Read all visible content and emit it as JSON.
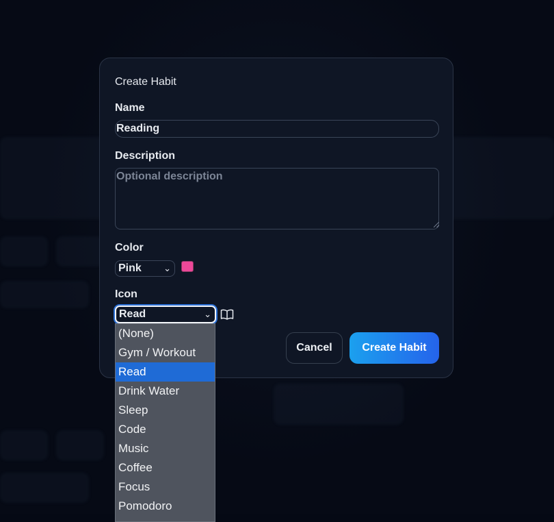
{
  "dialog": {
    "title": "Create Habit",
    "name": {
      "label": "Name",
      "value": "Reading"
    },
    "description": {
      "label": "Description",
      "value": "",
      "placeholder": "Optional description"
    },
    "color": {
      "label": "Color",
      "selected": "Pink",
      "swatch_color": "#ec4899"
    },
    "icon": {
      "label": "Icon",
      "selected": "Read",
      "preview_icon": "book-open-icon"
    },
    "buttons": {
      "cancel": "Cancel",
      "create": "Create Habit"
    }
  },
  "icon_dropdown": {
    "options": [
      "(None)",
      "Gym / Workout",
      "Read",
      "Drink Water",
      "Sleep",
      "Code",
      "Music",
      "Coffee",
      "Focus",
      "Pomodoro"
    ],
    "selected_index": 2
  }
}
